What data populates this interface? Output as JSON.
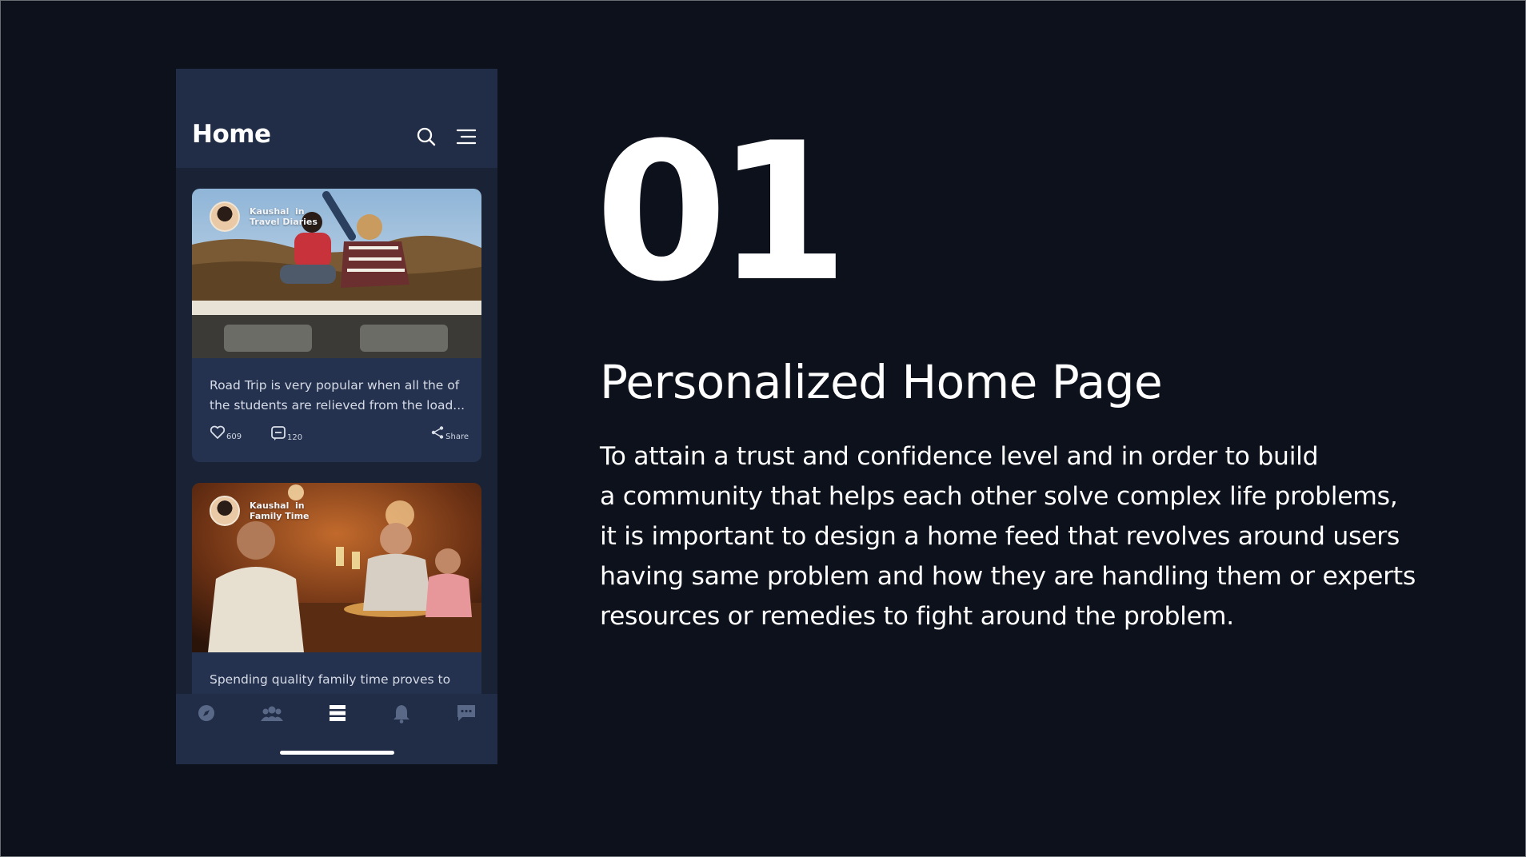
{
  "phone": {
    "header": {
      "title": "Home",
      "search_icon": "search-icon",
      "menu_icon": "menu-icon"
    },
    "posts": [
      {
        "author": "Kaushal",
        "connector": "in",
        "group": "Travel Diaries",
        "text": "Road Trip is very popular when all the of the students are relieved from the load...",
        "likes": "609",
        "comments": "120",
        "share_label": "Share"
      },
      {
        "author": "Kaushal",
        "connector": "in",
        "group": "Family Time",
        "text": "Spending quality family time proves to be"
      }
    ],
    "bottom_nav": [
      {
        "icon": "compass-icon",
        "active": false
      },
      {
        "icon": "community-icon",
        "active": false
      },
      {
        "icon": "feed-icon",
        "active": true
      },
      {
        "icon": "bell-icon",
        "active": false
      },
      {
        "icon": "chat-icon",
        "active": false
      }
    ]
  },
  "slide": {
    "number": "01",
    "title": "Personalized Home Page",
    "description_lines": [
      "To attain a trust and confidence level and in order to build",
      "a community that helps each other solve complex life problems,",
      "it is important to design a home feed that revolves around users",
      "having same problem and how they are handling them or experts",
      "resources or remedies to fight around the problem."
    ]
  },
  "colors": {
    "background": "#0c111b",
    "phone_bg": "#1a2235",
    "header_bg": "#212d47",
    "card_bg": "#243250",
    "text_primary": "#ffffff"
  }
}
